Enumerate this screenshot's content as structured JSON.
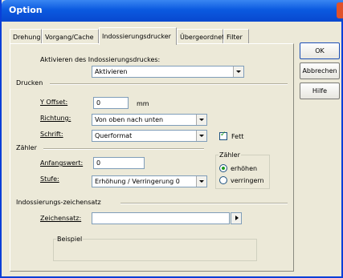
{
  "window": {
    "title": "Option"
  },
  "tabs": [
    {
      "label": "Drehung"
    },
    {
      "label": "Vorgang/Cache"
    },
    {
      "label": "Indossierungsdrucker"
    },
    {
      "label": "Übergeordnet"
    },
    {
      "label": "Filter"
    }
  ],
  "activate": {
    "label": "Aktivieren des Indossierungsdruckes:",
    "value": "Aktivieren"
  },
  "drucken": {
    "header": "Drucken",
    "y_offset_label": "Y Offset:",
    "y_offset_value": "0",
    "y_offset_unit": "mm",
    "richtung_label": "Richtung:",
    "richtung_value": "Von oben nach unten",
    "schrift_label": "Schrift:",
    "schrift_value": "Querformat",
    "fett_label": "Fett",
    "fett_checked": true
  },
  "zahler": {
    "header": "Zähler",
    "anfangswert_label": "Anfangswert:",
    "anfangswert_value": "0",
    "stufe_label": "Stufe:",
    "stufe_value": "Erhöhung / Verringerung 0",
    "group_label": "Zähler",
    "radio_up": "erhöhen",
    "radio_down": "verringern",
    "selected": "erhöhen"
  },
  "zeichensatz": {
    "header": "Indossierungs-zeichensatz",
    "label": "Zeichensatz:",
    "value": "",
    "beispiel_label": "Beispiel"
  },
  "buttons": {
    "ok": "OK",
    "abbrechen": "Abbrechen",
    "hilfe": "Hilfe"
  },
  "colors": {
    "titlebar": "#0b5ae0",
    "dialog_bg": "#ece9d8",
    "close": "#e0512a"
  }
}
